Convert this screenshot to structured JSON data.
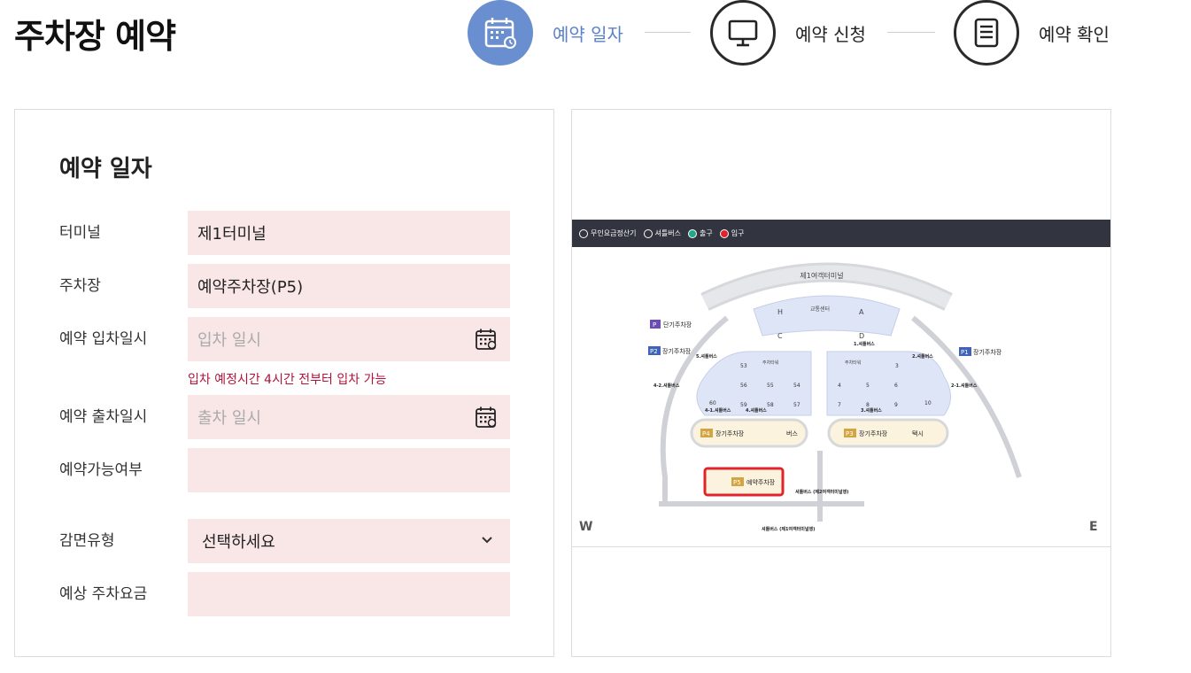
{
  "page": {
    "title": "주차장 예약"
  },
  "steps": [
    {
      "label": "예약 일자",
      "state": "active",
      "icon": "calendar-icon"
    },
    {
      "label": "예약 신청",
      "state": "inactive",
      "icon": "monitor-icon"
    },
    {
      "label": "예약 확인",
      "state": "inactive",
      "icon": "document-icon"
    }
  ],
  "form": {
    "title": "예약 일자",
    "terminal": {
      "label": "터미널",
      "value": "제1터미널"
    },
    "parking_lot": {
      "label": "주차장",
      "value": "예약주차장(P5)"
    },
    "entry": {
      "label": "예약 입차일시",
      "placeholder": "입차 일시",
      "icon": "calendar-icon"
    },
    "notice": "입차 예정시간 4시간 전부터 입차 가능",
    "exit": {
      "label": "예약 출차일시",
      "placeholder": "출차 일시",
      "icon": "calendar-icon"
    },
    "availability": {
      "label": "예약가능여부",
      "value": ""
    },
    "discount": {
      "label": "감면유형",
      "value": "선택하세요",
      "icon": "chevron-down-icon"
    },
    "fee": {
      "label": "예상 주차요금",
      "value": ""
    }
  },
  "map": {
    "legend": [
      {
        "label": "무인요금정산기",
        "icon": "payment-kiosk-icon"
      },
      {
        "label": "셔틀버스",
        "icon": "shuttle-bus-icon"
      },
      {
        "label": "출구",
        "icon": "exit-icon"
      },
      {
        "label": "입구",
        "icon": "entrance-icon"
      }
    ],
    "terminal_name": "제1여객터미널",
    "transport_center": "교통센터",
    "zones": {
      "h": "H",
      "a": "A",
      "c": "C",
      "d": "D"
    },
    "tags": {
      "p": "P",
      "p1": "P1",
      "p2": "P2",
      "p3": "P3",
      "p4": "P4",
      "p5": "P5"
    },
    "labels": {
      "short_term": "단기주차장",
      "long_term_p1": "장기주차장",
      "long_term_p2": "장기주차장",
      "long_term_p3": "장기주차장",
      "long_term_p4": "장기주차장",
      "reserved": "예약주차장",
      "bus": "버스",
      "taxi": "택시",
      "tower_left": "주차타워",
      "tower_right": "주차타워"
    },
    "shuttle_stops": {
      "s5": "5.셔틀버스",
      "s1": "1.셔틀버스",
      "s2": "2.셔틀버스",
      "s42": "4-2.셔틀버스",
      "s41a": "4-1.셔틀버스",
      "s4": "4.셔틀버스",
      "s3": "3.셔틀버스",
      "s21": "2-1.셔틀버스",
      "s_t2": "셔틀버스 (제2여객터미널행)",
      "s_t1": "셔틀버스 (제1여객터미널행)"
    },
    "lots": [
      "53",
      "56",
      "55",
      "54",
      "60",
      "59",
      "58",
      "57",
      "3",
      "4",
      "5",
      "6",
      "7",
      "8",
      "9",
      "10"
    ],
    "compass": {
      "west": "W",
      "east": "E"
    },
    "colors": {
      "legend_bar": "#32343f",
      "lot_fill": "#dde5f7",
      "tag_blue": "#3e63b8",
      "tag_gold": "#d2a542",
      "highlight": "#e0242b"
    }
  }
}
